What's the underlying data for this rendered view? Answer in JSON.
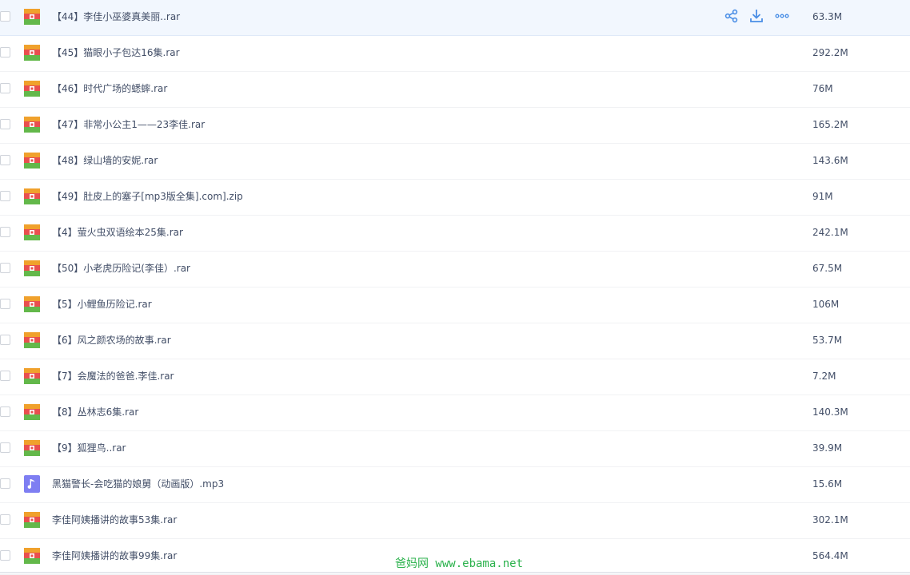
{
  "files": [
    {
      "name": "【44】李佳小巫婆真美丽..rar",
      "size": "63.3M",
      "type": "archive",
      "hover": true
    },
    {
      "name": "【45】猫眼小子包达16集.rar",
      "size": "292.2M",
      "type": "archive"
    },
    {
      "name": "【46】时代广场的蟋蟀.rar",
      "size": "76M",
      "type": "archive"
    },
    {
      "name": "【47】非常小公主1——23李佳.rar",
      "size": "165.2M",
      "type": "archive"
    },
    {
      "name": "【48】绿山墙的安妮.rar",
      "size": "143.6M",
      "type": "archive"
    },
    {
      "name": "【49】肚皮上的塞子[mp3版全集].com].zip",
      "size": "91M",
      "type": "archive"
    },
    {
      "name": "【4】萤火虫双语绘本25集.rar",
      "size": "242.1M",
      "type": "archive"
    },
    {
      "name": "【50】小老虎历险记(李佳）.rar",
      "size": "67.5M",
      "type": "archive"
    },
    {
      "name": "【5】小鲤鱼历险记.rar",
      "size": "106M",
      "type": "archive"
    },
    {
      "name": "【6】风之颜农场的故事.rar",
      "size": "53.7M",
      "type": "archive"
    },
    {
      "name": "【7】会魔法的爸爸.李佳.rar",
      "size": "7.2M",
      "type": "archive"
    },
    {
      "name": "【8】丛林志6集.rar",
      "size": "140.3M",
      "type": "archive"
    },
    {
      "name": "【9】狐狸鸟..rar",
      "size": "39.9M",
      "type": "archive"
    },
    {
      "name": "黑猫警长-会吃猫的娘舅（动画版）.mp3",
      "size": "15.6M",
      "type": "audio"
    },
    {
      "name": "李佳阿姨播讲的故事53集.rar",
      "size": "302.1M",
      "type": "archive"
    },
    {
      "name": "李佳阿姨播讲的故事99集.rar",
      "size": "564.4M",
      "type": "archive"
    }
  ],
  "row_actions": {
    "share_icon": "share-icon",
    "download_icon": "download-icon",
    "more_icon": "more-icon"
  },
  "watermark": "爸妈网 www.ebama.net",
  "colors": {
    "accent": "#4a8ee6",
    "text": "#424e67",
    "hover_row": "#f2f7fe",
    "watermark": "#2bb24c",
    "audio_icon": "#7e7ef2"
  }
}
